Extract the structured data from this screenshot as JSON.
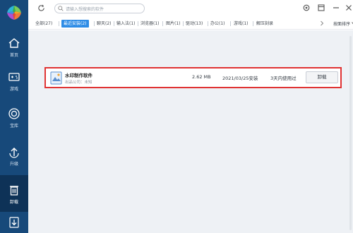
{
  "sidebar": {
    "items": [
      {
        "label": "首页",
        "icon": "home-icon"
      },
      {
        "label": "游戏",
        "icon": "gamepad-icon"
      },
      {
        "label": "宝库",
        "icon": "treasure-icon"
      },
      {
        "label": "升级",
        "icon": "upgrade-icon"
      },
      {
        "label": "卸载",
        "icon": "trash-icon",
        "active": true
      },
      {
        "label": "",
        "icon": "download-icon"
      }
    ]
  },
  "search": {
    "placeholder": "请输入想搜索的软件"
  },
  "tabs": [
    {
      "label": "全部(27)"
    },
    {
      "label": "最近安装(2)",
      "active": true
    },
    {
      "label": "聊天(2)"
    },
    {
      "label": "输入法(1)"
    },
    {
      "label": "浏览器(1)"
    },
    {
      "label": "图片(1)"
    },
    {
      "label": "驱动(13)"
    },
    {
      "label": "办公(1)"
    },
    {
      "label": "游戏(1)"
    },
    {
      "label": "解压刻录"
    }
  ],
  "sort": {
    "label": "按面排序"
  },
  "apps": [
    {
      "name": "水印制作软件",
      "publisher": "出品公司：未知",
      "size": "2.62 MB",
      "install_date": "2021/03/25安装",
      "last_used": "3天内使用过",
      "action": "卸载"
    }
  ],
  "colors": {
    "sidebar": "#17497a",
    "accent": "#2e8ce6",
    "highlight": "#e03333"
  }
}
